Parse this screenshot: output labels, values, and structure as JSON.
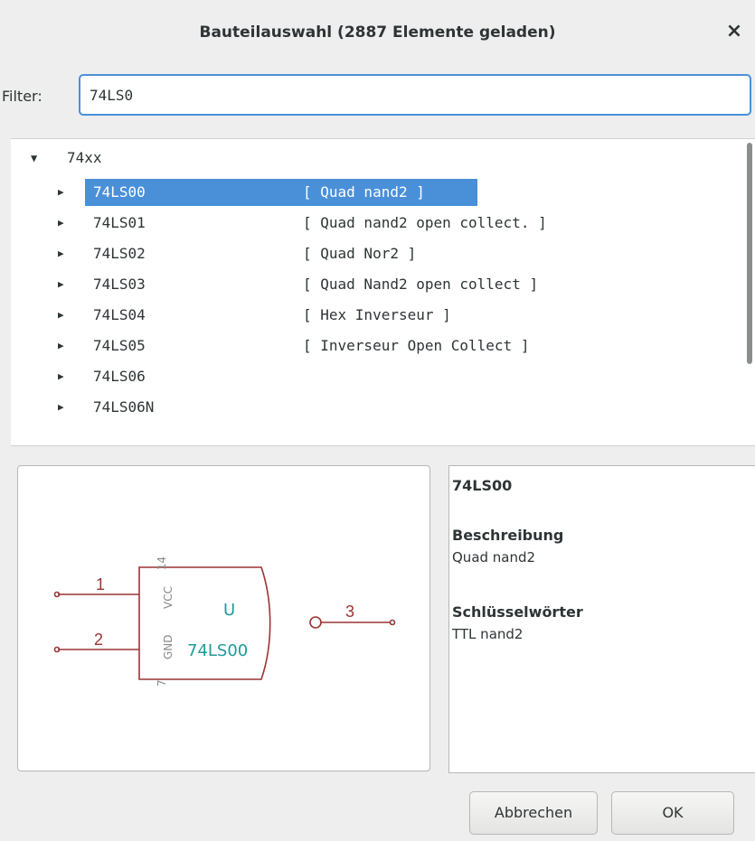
{
  "window": {
    "title": "Bauteilauswahl (2887 Elemente geladen)",
    "close_symbol": "×"
  },
  "filter": {
    "label": "Filter:",
    "value": "74LS0"
  },
  "tree": {
    "root": {
      "label": "74xx",
      "expanded": true
    },
    "items": [
      {
        "name": "74LS00",
        "desc": "[ Quad nand2 ]",
        "selected": true
      },
      {
        "name": "74LS01",
        "desc": "[ Quad nand2 open collect. ]"
      },
      {
        "name": "74LS02",
        "desc": "[ Quad Nor2 ]"
      },
      {
        "name": "74LS03",
        "desc": "[ Quad Nand2 open collect ]"
      },
      {
        "name": "74LS04",
        "desc": "[ Hex Inverseur ]"
      },
      {
        "name": "74LS05",
        "desc": "[ Inverseur Open Collect ]"
      },
      {
        "name": "74LS06",
        "desc": ""
      },
      {
        "name": "74LS06N",
        "desc": ""
      }
    ]
  },
  "preview": {
    "reference": "U",
    "value": "74LS00",
    "pins": {
      "in1": "1",
      "in2": "2",
      "out": "3",
      "vcc_num": "14",
      "vcc": "VCC",
      "gnd": "GND",
      "gnd_num": "7"
    },
    "colors": {
      "body": "#9b3434",
      "text": "#1f9a9a",
      "pin_label": "#8a8a8a"
    }
  },
  "info": {
    "part_name": "74LS00",
    "description_heading": "Beschreibung",
    "description": "Quad nand2",
    "keywords_heading": "Schlüsselwörter",
    "keywords": "TTL nand2"
  },
  "buttons": {
    "cancel": "Abbrechen",
    "ok": "OK"
  },
  "colors": {
    "accent": "#4a90d9",
    "background": "#eeeeee"
  }
}
